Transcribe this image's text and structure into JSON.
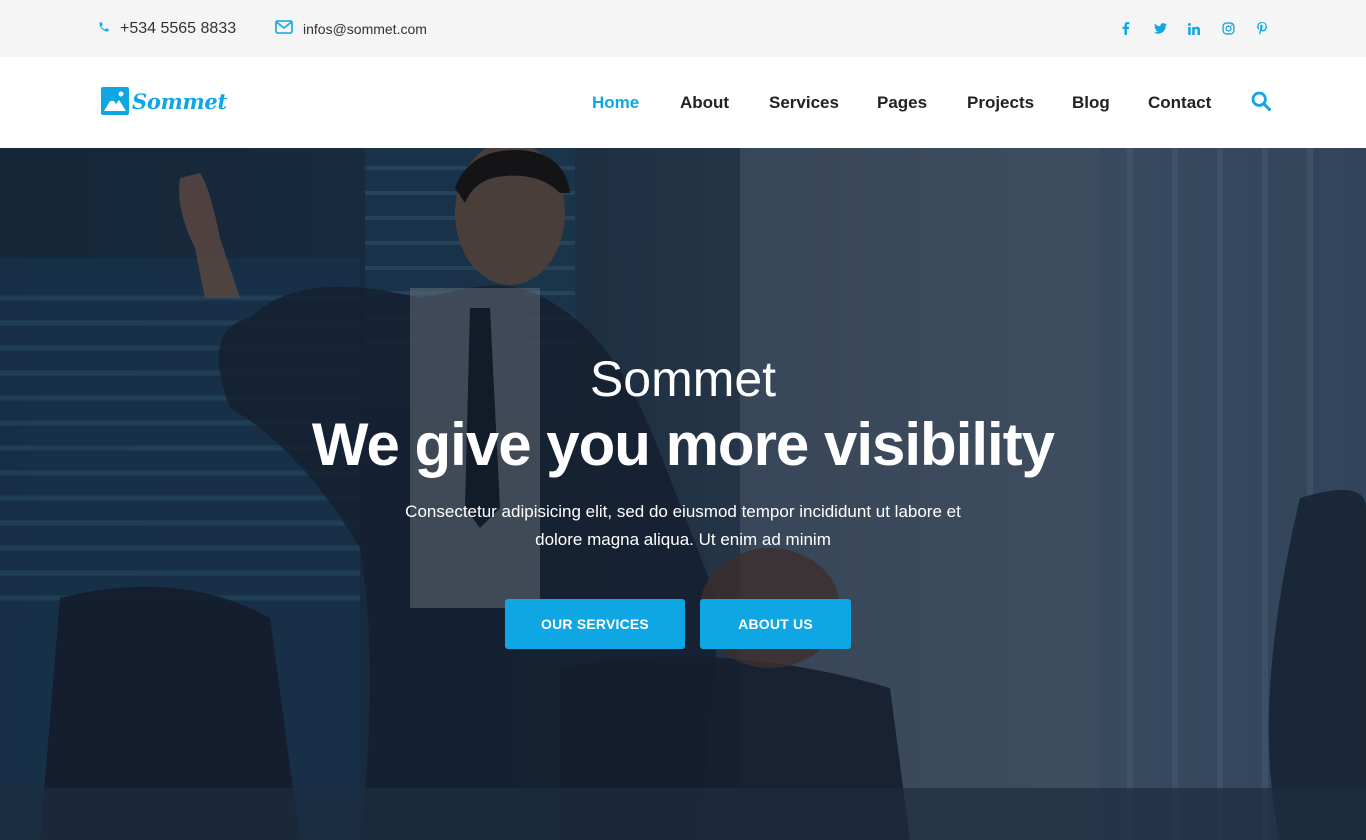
{
  "topbar": {
    "phone": "+534 5565 8833",
    "email": "infos@sommet.com",
    "socials": [
      "facebook-icon",
      "twitter-icon",
      "linkedin-icon",
      "instagram-icon",
      "pinterest-icon"
    ]
  },
  "header": {
    "logo_text": "Sommet",
    "nav": [
      {
        "label": "Home",
        "active": true
      },
      {
        "label": "About",
        "active": false
      },
      {
        "label": "Services",
        "active": false
      },
      {
        "label": "Pages",
        "active": false
      },
      {
        "label": "Projects",
        "active": false
      },
      {
        "label": "Blog",
        "active": false
      },
      {
        "label": "Contact",
        "active": false
      }
    ],
    "search_icon": "search-icon"
  },
  "hero": {
    "subtitle": "Sommet",
    "title": "We give you more visibility",
    "description": "Consectetur adipisicing elit, sed do eiusmod tempor incididunt ut labore et dolore magna aliqua. Ut enim ad minim",
    "buttons": {
      "services": "OUR SERVICES",
      "about": "ABOUT US"
    }
  },
  "colors": {
    "accent": "#0fa6e4",
    "topbar_bg": "#f5f5f5",
    "text_dark": "#222222"
  }
}
